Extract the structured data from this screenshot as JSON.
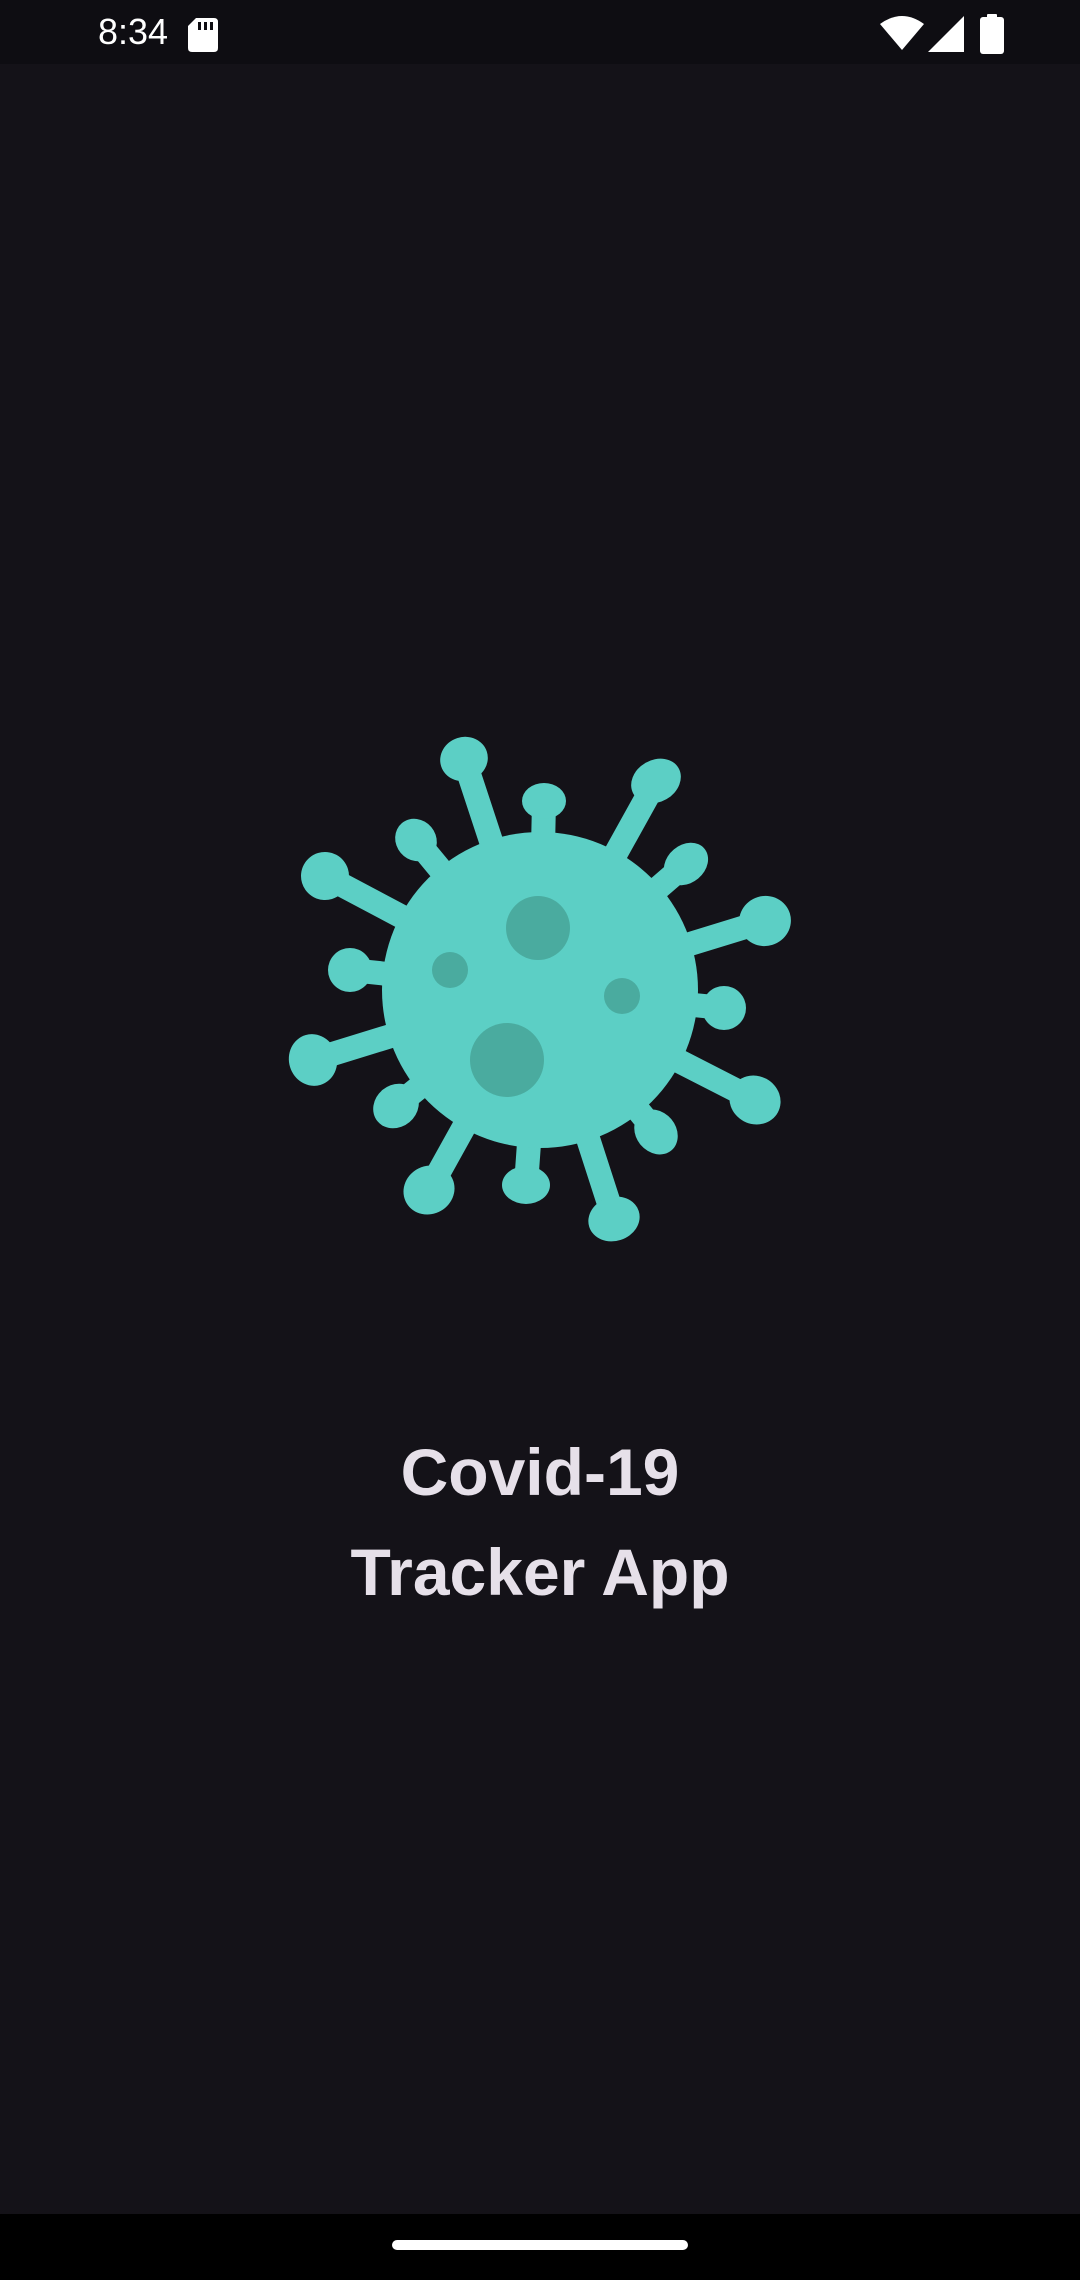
{
  "status_bar": {
    "time": "8:34",
    "icons": [
      "sd-card-icon",
      "wifi-icon",
      "signal-icon",
      "battery-icon"
    ]
  },
  "splash": {
    "logo_icon": "virus-icon",
    "title_line1": "Covid-19",
    "title_line2": "Tracker App"
  },
  "colors": {
    "background": "#141218",
    "status_bar": "#0e0d12",
    "accent": "#5ccfc5",
    "accent_dark": "#4aab9f",
    "title_text": "#e6e0e9"
  },
  "nav_bar": {
    "type": "gesture-handle"
  }
}
